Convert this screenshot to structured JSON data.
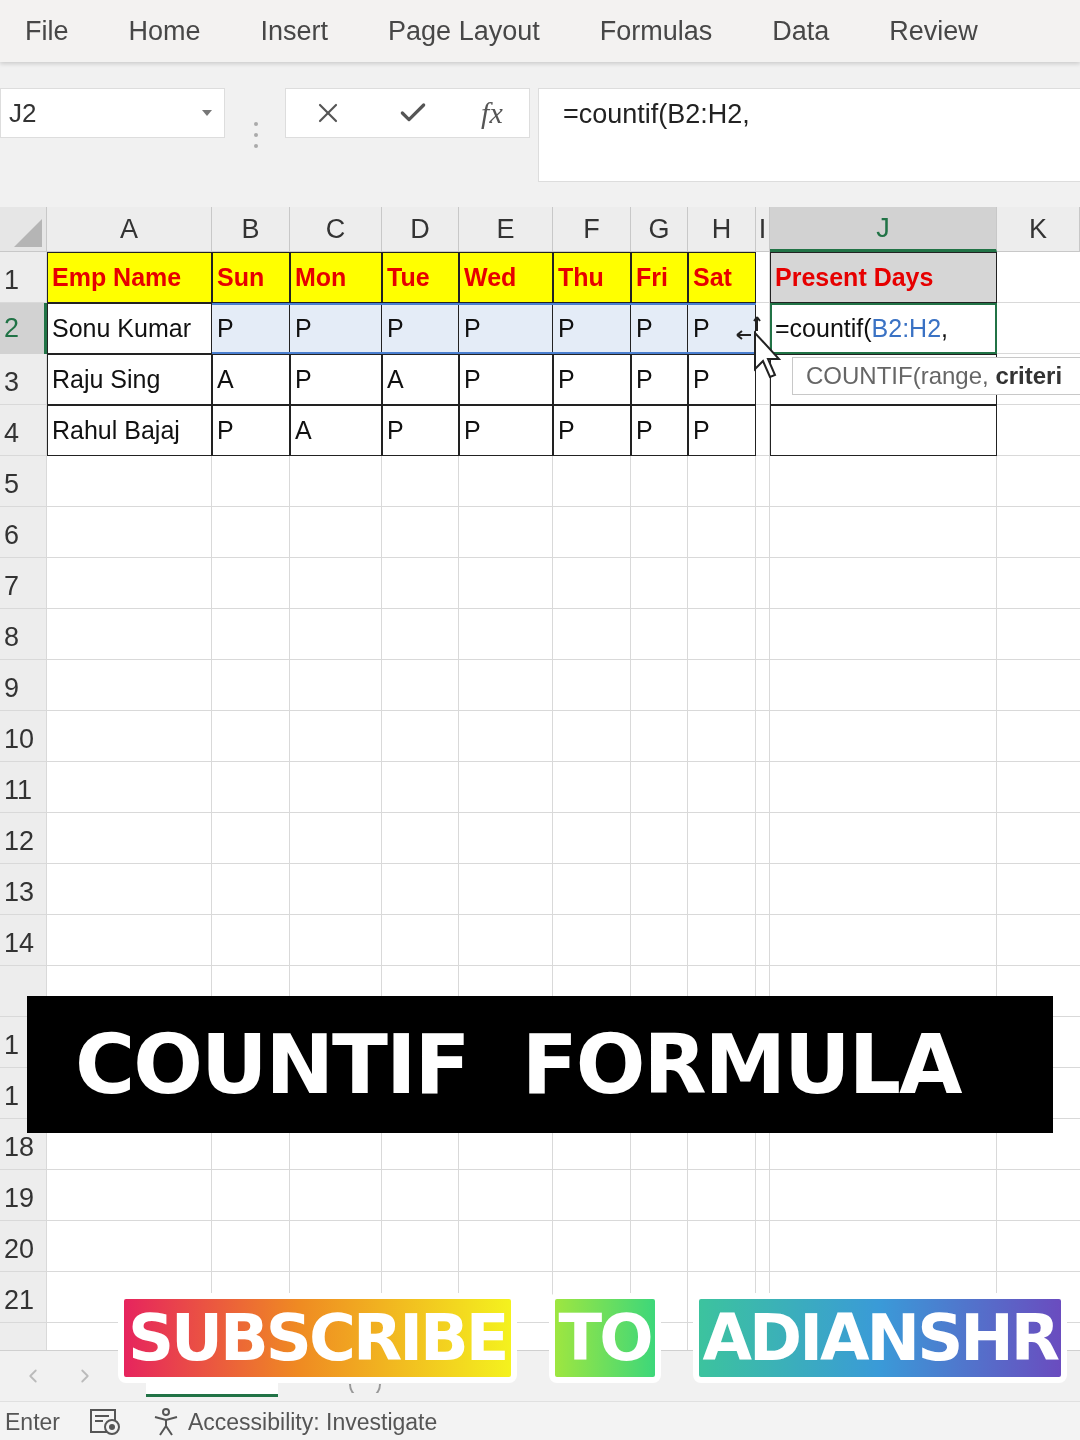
{
  "menu": [
    {
      "label": "File"
    },
    {
      "label": "Home"
    },
    {
      "label": "Insert"
    },
    {
      "label": "Page Layout"
    },
    {
      "label": "Formulas"
    },
    {
      "label": "Data"
    },
    {
      "label": "Review"
    }
  ],
  "name_box": {
    "value": "J2"
  },
  "formula_buttons": {
    "function_label": "fx"
  },
  "formula_bar": {
    "value": "=countif(B2:H2,"
  },
  "columns": [
    {
      "label": "A",
      "selected": false
    },
    {
      "label": "B",
      "selected": false
    },
    {
      "label": "C",
      "selected": false
    },
    {
      "label": "D",
      "selected": false
    },
    {
      "label": "E",
      "selected": false
    },
    {
      "label": "F",
      "selected": false
    },
    {
      "label": "G",
      "selected": false
    },
    {
      "label": "H",
      "selected": false
    },
    {
      "label": "I",
      "selected": false
    },
    {
      "label": "J",
      "selected": true
    },
    {
      "label": "K",
      "selected": false
    }
  ],
  "rows": [
    {
      "header": "1",
      "selected": false,
      "cells": [
        {
          "kind": "header",
          "text": "Emp Name",
          "selected": false
        },
        {
          "kind": "header",
          "text": "Sun",
          "selected": false
        },
        {
          "kind": "header",
          "text": "Mon",
          "selected": false
        },
        {
          "kind": "header",
          "text": "Tue",
          "selected": false
        },
        {
          "kind": "header",
          "text": "Wed",
          "selected": false
        },
        {
          "kind": "header",
          "text": "Thu",
          "selected": false
        },
        {
          "kind": "header",
          "text": "Fri",
          "selected": false
        },
        {
          "kind": "header",
          "text": "Sat",
          "selected": false
        },
        null,
        {
          "kind": "header_gray",
          "text": "Present Days",
          "selected": false
        },
        null
      ]
    },
    {
      "header": "2",
      "selected": true,
      "cells": [
        {
          "kind": "data",
          "text": "Sonu Kumar",
          "selected": false
        },
        {
          "kind": "data",
          "text": "P",
          "selected": true
        },
        {
          "kind": "data",
          "text": "P",
          "selected": true
        },
        {
          "kind": "data",
          "text": "P",
          "selected": true
        },
        {
          "kind": "data",
          "text": "P",
          "selected": true
        },
        {
          "kind": "data",
          "text": "P",
          "selected": true
        },
        {
          "kind": "data",
          "text": "P",
          "selected": true
        },
        {
          "kind": "data",
          "text": "P",
          "selected": true
        },
        null,
        {
          "kind": "editing",
          "parts": [
            {
              "text": "=countif("
            },
            {
              "text": "B2:H2",
              "kind": "reference"
            },
            {
              "text": ","
            }
          ],
          "selected": false
        },
        null
      ]
    },
    {
      "header": "3",
      "selected": false,
      "cells": [
        {
          "kind": "data",
          "text": "Raju Sing",
          "selected": false
        },
        {
          "kind": "data",
          "text": "A",
          "selected": false
        },
        {
          "kind": "data",
          "text": "P",
          "selected": false
        },
        {
          "kind": "data",
          "text": "A",
          "selected": false
        },
        {
          "kind": "data",
          "text": "P",
          "selected": false
        },
        {
          "kind": "data",
          "text": "P",
          "selected": false
        },
        {
          "kind": "data",
          "text": "P",
          "selected": false
        },
        {
          "kind": "data",
          "text": "P",
          "selected": false
        },
        null,
        {
          "kind": "blank",
          "selected": false
        },
        null
      ]
    },
    {
      "header": "4",
      "selected": false,
      "cells": [
        {
          "kind": "data",
          "text": "Rahul Bajaj",
          "selected": false
        },
        {
          "kind": "data",
          "text": "P",
          "selected": false
        },
        {
          "kind": "data",
          "text": "A",
          "selected": false
        },
        {
          "kind": "data",
          "text": "P",
          "selected": false
        },
        {
          "kind": "data",
          "text": "P",
          "selected": false
        },
        {
          "kind": "data",
          "text": "P",
          "selected": false
        },
        {
          "kind": "data",
          "text": "P",
          "selected": false
        },
        {
          "kind": "data",
          "text": "P",
          "selected": false
        },
        null,
        {
          "kind": "blank",
          "selected": false
        },
        null
      ]
    },
    {
      "header": "5",
      "selected": false
    },
    {
      "header": "6",
      "selected": false
    },
    {
      "header": "7",
      "selected": false
    },
    {
      "header": "8",
      "selected": false
    },
    {
      "header": "9",
      "selected": false
    },
    {
      "header": "10",
      "selected": false
    },
    {
      "header": "11",
      "selected": false
    },
    {
      "header": "12",
      "selected": false
    },
    {
      "header": "13",
      "selected": false
    },
    {
      "header": "14",
      "selected": false
    },
    {
      "selected": false
    },
    {
      "header": "1",
      "selected": false
    },
    {
      "header": "1",
      "selected": false
    },
    {
      "header": "18",
      "selected": false
    },
    {
      "header": "19",
      "selected": false
    },
    {
      "header": "20",
      "selected": false
    },
    {
      "header": "21",
      "selected": false
    }
  ],
  "tooltip": {
    "text": "COUNTIF(range, **criteri**"
  },
  "caption": {
    "text": "COUNTIF  FORMULA"
  },
  "promo": [
    {
      "text": "SUBSCRIBE",
      "kind": "warm"
    },
    {
      "text": "TO",
      "kind": "green"
    },
    {
      "text": "ADIANSHR",
      "kind": "cool"
    }
  ],
  "status_bar": {
    "mode": "Enter",
    "accessibility": "Accessibility: Investigate"
  }
}
